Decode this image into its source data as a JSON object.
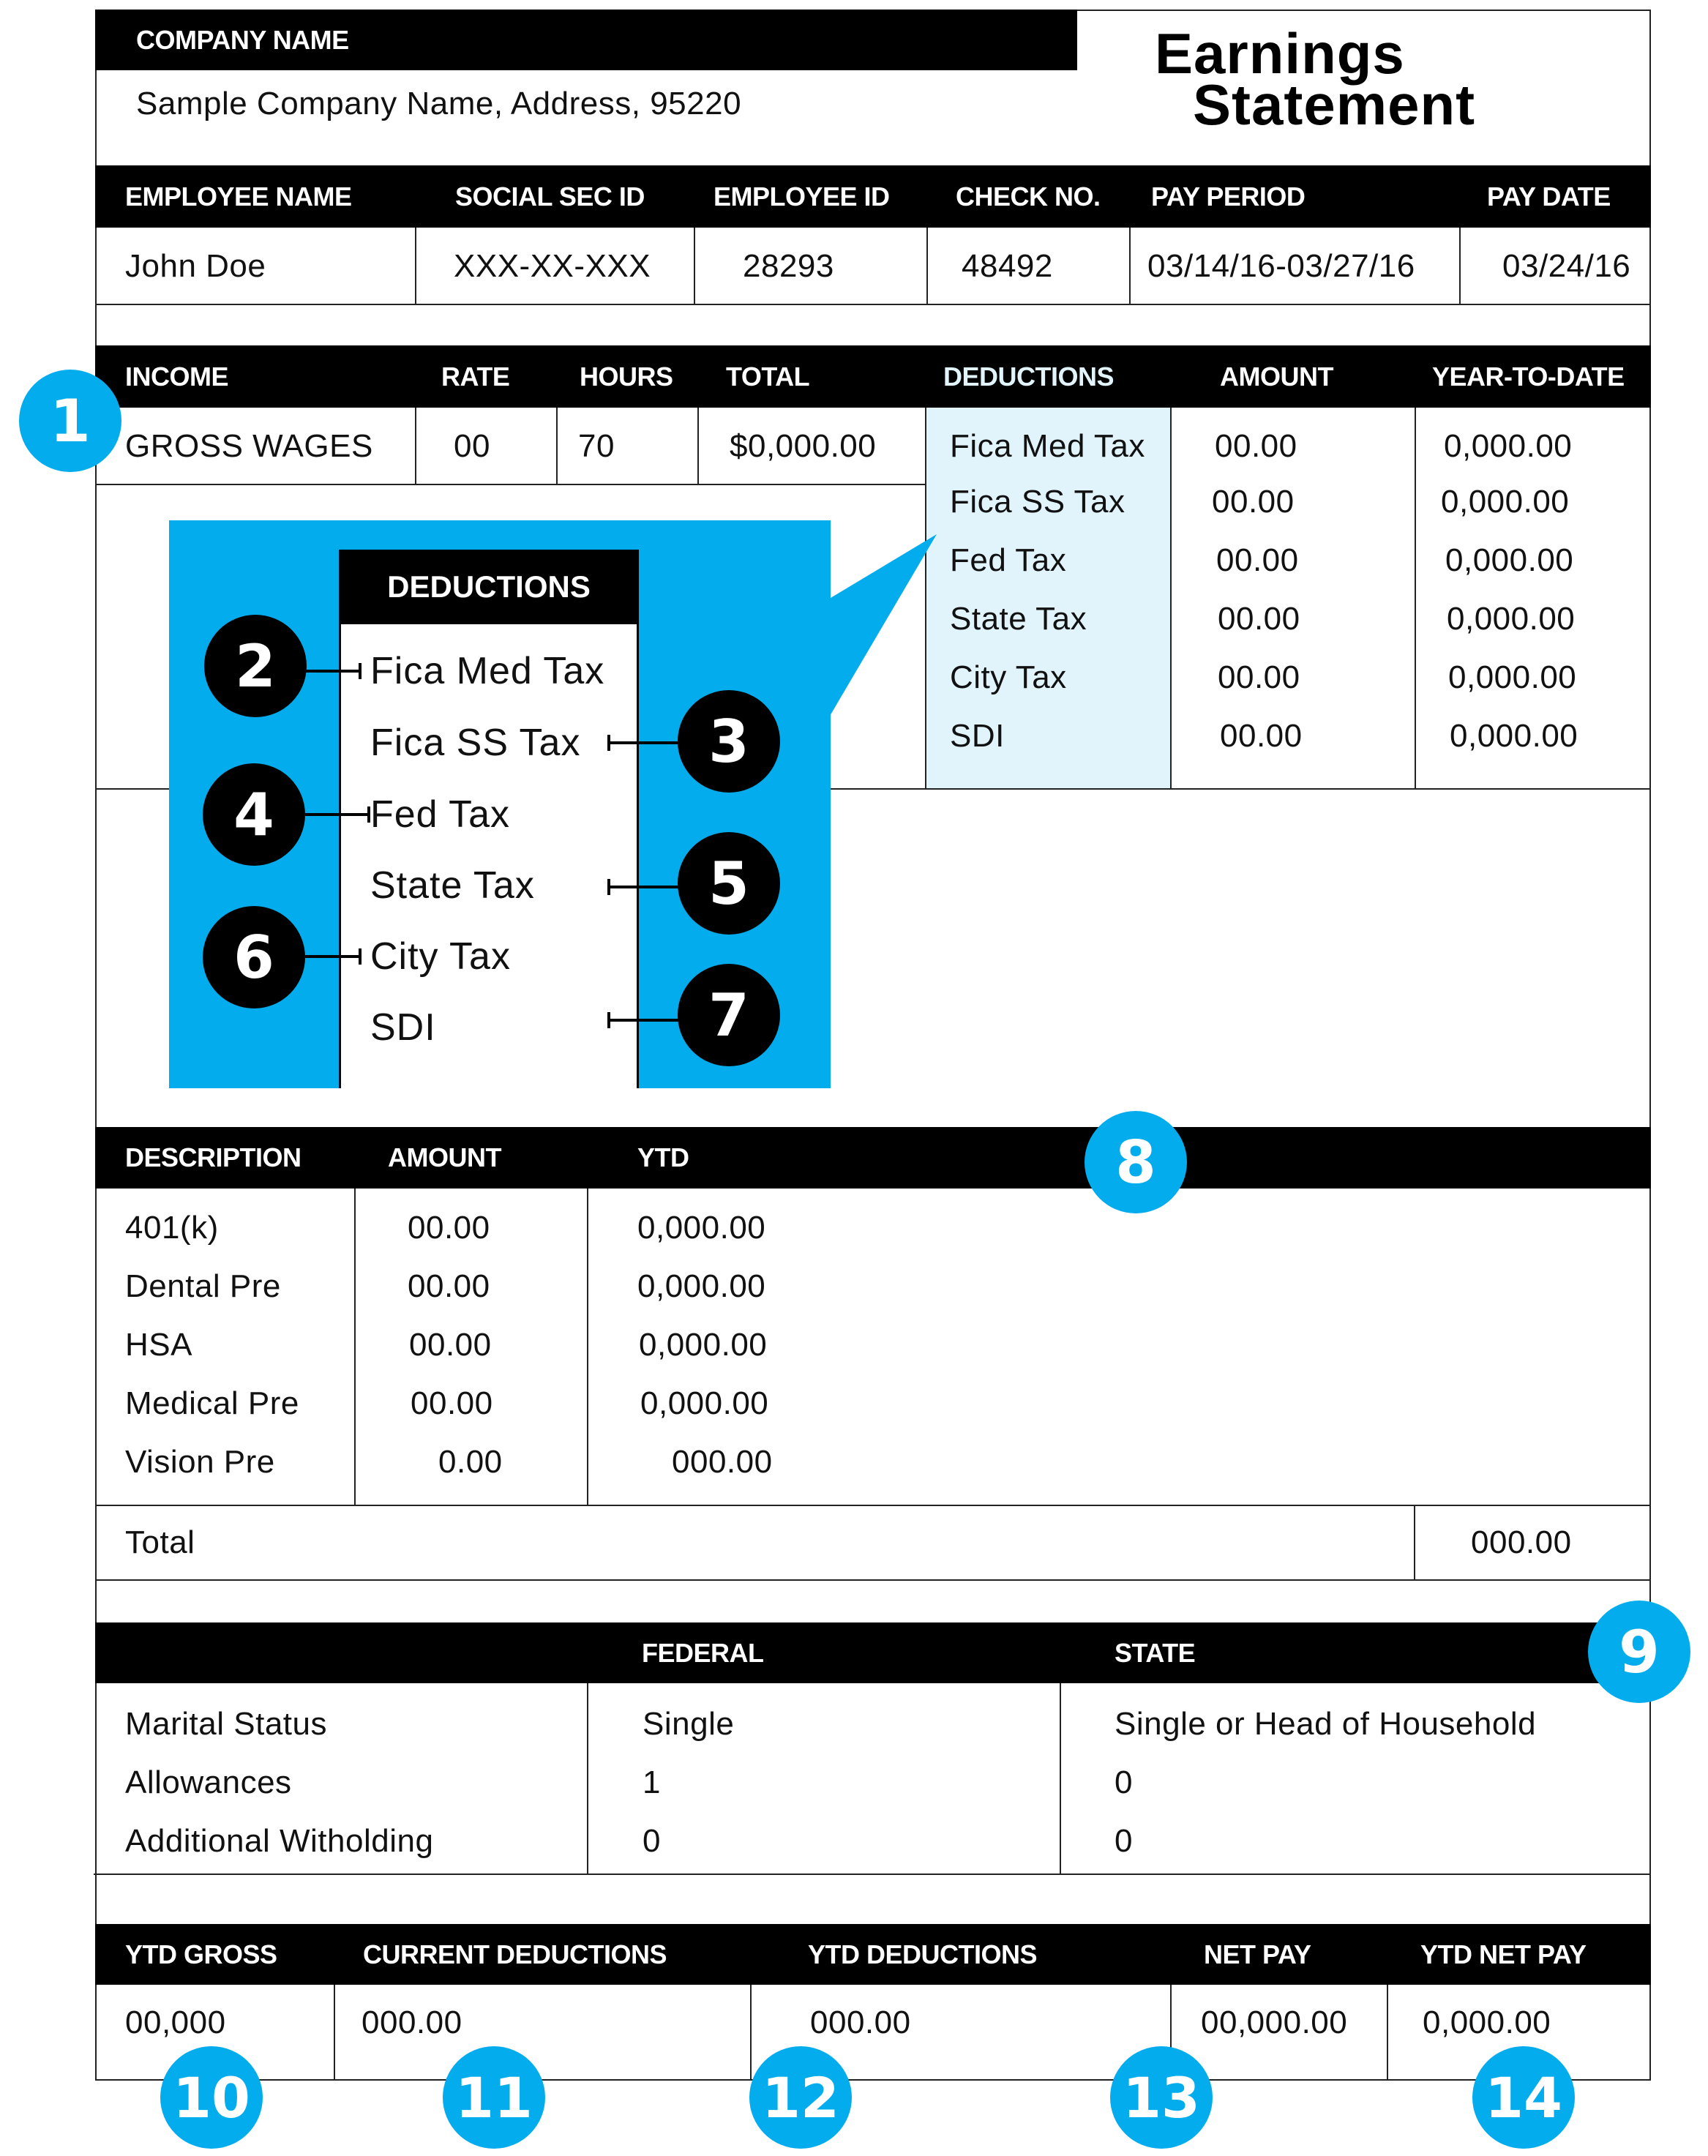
{
  "header": {
    "company_label": "COMPANY NAME",
    "company_address": "Sample Company Name, Address, 95220",
    "title_line1": "Earnings",
    "title_line2": "Statement"
  },
  "employee": {
    "columns": [
      "EMPLOYEE NAME",
      "SOCIAL SEC ID",
      "EMPLOYEE ID",
      "CHECK NO.",
      "PAY PERIOD",
      "PAY DATE"
    ],
    "values": [
      "John Doe",
      "XXX-XX-XXX",
      "28293",
      "48492",
      "03/14/16-03/27/16",
      "03/24/16"
    ]
  },
  "income": {
    "columns": [
      "INCOME",
      "RATE",
      "HOURS",
      "TOTAL"
    ],
    "row": [
      "GROSS WAGES",
      "00",
      "70",
      "$0,000.00"
    ]
  },
  "deductions": {
    "columns": [
      "DEDUCTIONS",
      "AMOUNT",
      "YEAR-TO-DATE"
    ],
    "rows": [
      {
        "name": "Fica Med Tax",
        "amount": "00.00",
        "ytd": "0,000.00"
      },
      {
        "name": "Fica SS Tax",
        "amount": "00.00",
        "ytd": "0,000.00"
      },
      {
        "name": "Fed Tax",
        "amount": "00.00",
        "ytd": "0,000.00"
      },
      {
        "name": "State Tax",
        "amount": "00.00",
        "ytd": "0,000.00"
      },
      {
        "name": "City Tax",
        "amount": "00.00",
        "ytd": "0,000.00"
      },
      {
        "name": "SDI",
        "amount": "00.00",
        "ytd": "0,000.00"
      }
    ]
  },
  "callout": {
    "heading": "DEDUCTIONS",
    "items": [
      "Fica Med Tax",
      "Fica SS Tax",
      "Fed Tax",
      "State Tax",
      "City Tax",
      "SDI"
    ],
    "badges": [
      "2",
      "3",
      "4",
      "5",
      "6",
      "7"
    ]
  },
  "pretax": {
    "columns": [
      "DESCRIPTION",
      "AMOUNT",
      "YTD"
    ],
    "rows": [
      {
        "name": "401(k)",
        "amount": "00.00",
        "ytd": "0,000.00"
      },
      {
        "name": "Dental Pre",
        "amount": "00.00",
        "ytd": "0,000.00"
      },
      {
        "name": "HSA",
        "amount": "00.00",
        "ytd": "0,000.00"
      },
      {
        "name": "Medical Pre",
        "amount": "00.00",
        "ytd": "0,000.00"
      },
      {
        "name": "Vision Pre",
        "amount": "0.00",
        "ytd": "000.00"
      }
    ],
    "total_label": "Total",
    "total_value": "000.00"
  },
  "withholding": {
    "columns": [
      "",
      "FEDERAL",
      "STATE"
    ],
    "rows": [
      {
        "label": "Marital Status",
        "federal": "Single",
        "state": "Single or Head of Household"
      },
      {
        "label": "Allowances",
        "federal": "1",
        "state": "0"
      },
      {
        "label": "Additional Witholding",
        "federal": "0",
        "state": "0"
      }
    ]
  },
  "summary": {
    "columns": [
      "YTD GROSS",
      "CURRENT DEDUCTIONS",
      "YTD DEDUCTIONS",
      "NET PAY",
      "YTD NET PAY"
    ],
    "values": [
      "00,000",
      "000.00",
      "000.00",
      "00,000.00",
      "0,000.00"
    ]
  },
  "annotations": {
    "income_badge": "1",
    "pretax_badge": "8",
    "withholding_badge": "9",
    "summary_badges": [
      "10",
      "11",
      "12",
      "13",
      "14"
    ]
  },
  "colors": {
    "accent_blue": "#03aced",
    "highlight_blue": "#e1f4fc",
    "header_black": "#000000"
  }
}
